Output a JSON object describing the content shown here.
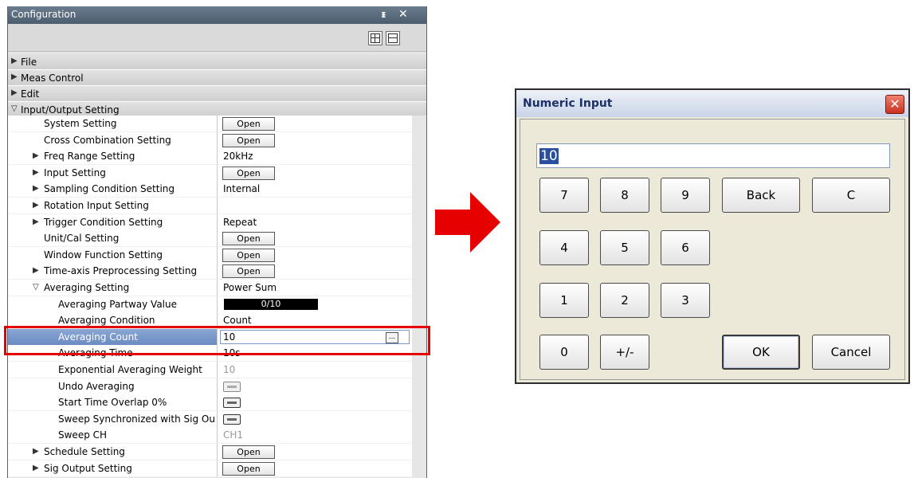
{
  "config": {
    "title": "Configuration",
    "pin": "ᵻ",
    "close": "✕",
    "sections": {
      "file": "File",
      "meas_control": "Meas Control",
      "edit": "Edit",
      "io_setting": "Input/Output Setting"
    },
    "rows": [
      {
        "label": "System Setting",
        "value": "Open",
        "kind": "button"
      },
      {
        "label": "Cross Combination Setting",
        "value": "Open",
        "kind": "button"
      },
      {
        "label": "Freq Range Setting",
        "value": "20kHz",
        "kind": "text"
      },
      {
        "label": "Input Setting",
        "value": "Open",
        "kind": "button"
      },
      {
        "label": "Sampling Condition Setting",
        "value": "Internal",
        "kind": "text"
      },
      {
        "label": "Rotation Input Setting",
        "value": "",
        "kind": "text"
      },
      {
        "label": "Trigger Condition Setting",
        "value": "Repeat",
        "kind": "text"
      },
      {
        "label": "Unit/Cal Setting",
        "value": "Open",
        "kind": "button"
      },
      {
        "label": "Window Function Setting",
        "value": "Open",
        "kind": "button"
      },
      {
        "label": "Time-axis Preprocessing Setting",
        "value": "Open",
        "kind": "button"
      },
      {
        "label": "Averaging Setting",
        "value": "Power Sum",
        "kind": "text"
      },
      {
        "label": "Averaging Partway Value",
        "value": "0/10",
        "kind": "progress"
      },
      {
        "label": "Averaging Condition",
        "value": "Count",
        "kind": "text"
      },
      {
        "label": "Averaging Count",
        "value": "10",
        "kind": "edit"
      },
      {
        "label": "Averaging Time",
        "value": "10s",
        "kind": "text"
      },
      {
        "label": "Exponential Averaging Weight",
        "value": "10",
        "kind": "gray"
      },
      {
        "label": "Undo Averaging",
        "value": "",
        "kind": "toggle-off"
      },
      {
        "label": "Start Time Overlap 0%",
        "value": "",
        "kind": "toggle-on"
      },
      {
        "label": "Sweep Synchronized with Sig Ou",
        "value": "",
        "kind": "toggle-on"
      },
      {
        "label": "Sweep CH",
        "value": "CH1",
        "kind": "gray"
      },
      {
        "label": "Schedule Setting",
        "value": "Open",
        "kind": "button"
      },
      {
        "label": "Sig Output Setting",
        "value": "Open",
        "kind": "button"
      }
    ],
    "ellipsis": "..."
  },
  "dialog": {
    "title": "Numeric Input",
    "close": "✕",
    "input_value": "10",
    "keys": {
      "k7": "7",
      "k8": "8",
      "k9": "9",
      "back": "Back",
      "clear": "C",
      "k4": "4",
      "k5": "5",
      "k6": "6",
      "k1": "1",
      "k2": "2",
      "k3": "3",
      "k0": "0",
      "sign": "+/-",
      "ok": "OK",
      "cancel": "Cancel"
    }
  },
  "colors": {
    "highlight": "#e60000",
    "arrow": "#e60000",
    "selected_row": "#6a8cc2"
  }
}
